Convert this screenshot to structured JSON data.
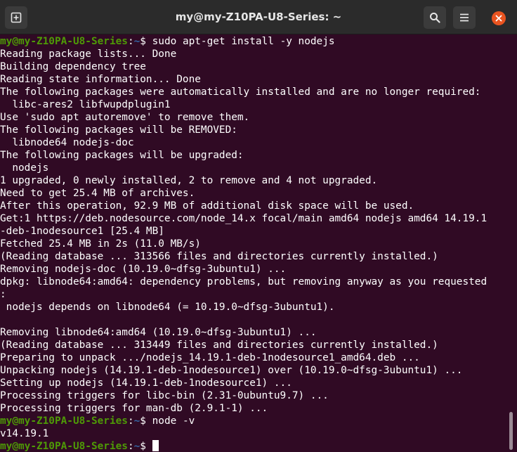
{
  "window": {
    "title": "my@my-Z10PA-U8-Series: ~",
    "buttons": {
      "new_tab_icon": "new-tab-icon",
      "search_icon": "search-icon",
      "menu_icon": "hamburger-menu-icon",
      "close_icon": "close-icon"
    }
  },
  "terminal": {
    "colors": {
      "background": "#300a24",
      "user_host": "#4e9a06",
      "path": "#3465a4",
      "text": "#ffffff"
    },
    "prompt": {
      "user_host": "my@my-Z10PA-U8-Series",
      "colon": ":",
      "path": "~",
      "dollar": "$ "
    },
    "lines": [
      {
        "type": "prompt",
        "command": "sudo apt-get install -y nodejs"
      },
      {
        "type": "output",
        "text": "Reading package lists... Done"
      },
      {
        "type": "output",
        "text": "Building dependency tree"
      },
      {
        "type": "output",
        "text": "Reading state information... Done"
      },
      {
        "type": "output",
        "text": "The following packages were automatically installed and are no longer required:"
      },
      {
        "type": "output",
        "text": "  libc-ares2 libfwupdplugin1"
      },
      {
        "type": "output",
        "text": "Use 'sudo apt autoremove' to remove them."
      },
      {
        "type": "output",
        "text": "The following packages will be REMOVED:"
      },
      {
        "type": "output",
        "text": "  libnode64 nodejs-doc"
      },
      {
        "type": "output",
        "text": "The following packages will be upgraded:"
      },
      {
        "type": "output",
        "text": "  nodejs"
      },
      {
        "type": "output",
        "text": "1 upgraded, 0 newly installed, 2 to remove and 4 not upgraded."
      },
      {
        "type": "output",
        "text": "Need to get 25.4 MB of archives."
      },
      {
        "type": "output",
        "text": "After this operation, 92.9 MB of additional disk space will be used."
      },
      {
        "type": "output",
        "text": "Get:1 https://deb.nodesource.com/node_14.x focal/main amd64 nodejs amd64 14.19.1"
      },
      {
        "type": "output",
        "text": "-deb-1nodesource1 [25.4 MB]"
      },
      {
        "type": "output",
        "text": "Fetched 25.4 MB in 2s (11.0 MB/s)"
      },
      {
        "type": "output",
        "text": "(Reading database ... 313566 files and directories currently installed.)"
      },
      {
        "type": "output",
        "text": "Removing nodejs-doc (10.19.0~dfsg-3ubuntu1) ..."
      },
      {
        "type": "output",
        "text": "dpkg: libnode64:amd64: dependency problems, but removing anyway as you requested"
      },
      {
        "type": "output",
        "text": ":"
      },
      {
        "type": "output",
        "text": " nodejs depends on libnode64 (= 10.19.0~dfsg-3ubuntu1)."
      },
      {
        "type": "output",
        "text": ""
      },
      {
        "type": "output",
        "text": "Removing libnode64:amd64 (10.19.0~dfsg-3ubuntu1) ..."
      },
      {
        "type": "output",
        "text": "(Reading database ... 313449 files and directories currently installed.)"
      },
      {
        "type": "output",
        "text": "Preparing to unpack .../nodejs_14.19.1-deb-1nodesource1_amd64.deb ..."
      },
      {
        "type": "output",
        "text": "Unpacking nodejs (14.19.1-deb-1nodesource1) over (10.19.0~dfsg-3ubuntu1) ..."
      },
      {
        "type": "output",
        "text": "Setting up nodejs (14.19.1-deb-1nodesource1) ..."
      },
      {
        "type": "output",
        "text": "Processing triggers for libc-bin (2.31-0ubuntu9.7) ..."
      },
      {
        "type": "output",
        "text": "Processing triggers for man-db (2.9.1-1) ..."
      },
      {
        "type": "prompt",
        "command": "node -v"
      },
      {
        "type": "output",
        "text": "v14.19.1"
      },
      {
        "type": "prompt",
        "command": "",
        "cursor": true
      }
    ]
  }
}
